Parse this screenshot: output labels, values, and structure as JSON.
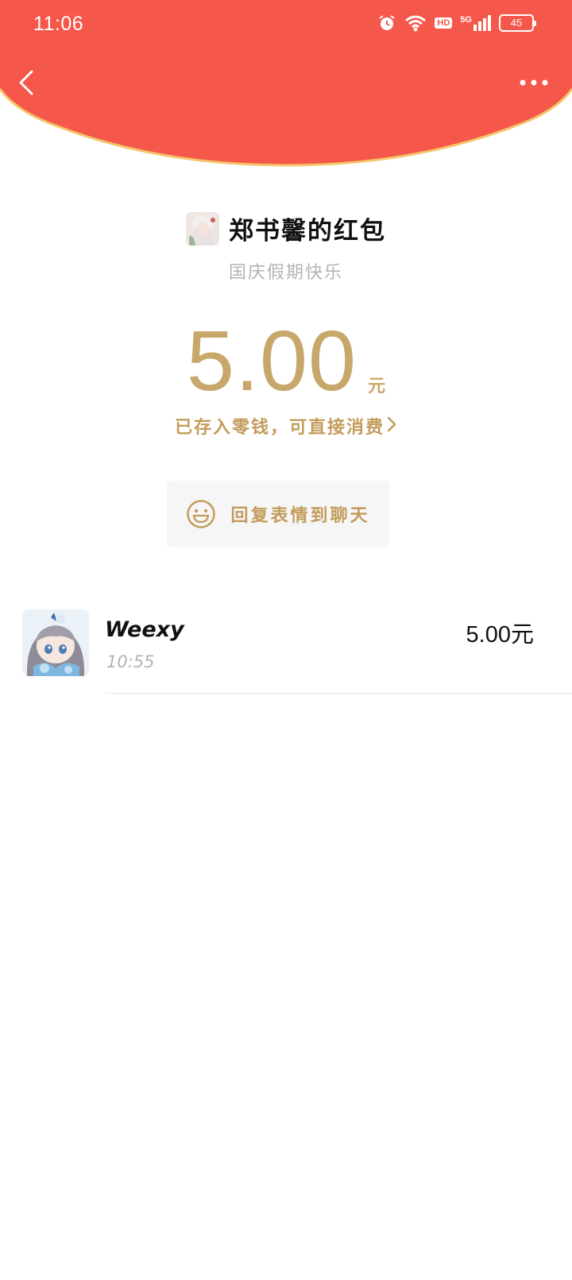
{
  "status_bar": {
    "time": "11:06",
    "hd_label": "HD",
    "network_label": "5G",
    "battery": "45"
  },
  "header": {
    "color": "#f5574a",
    "border_color": "#f4c56a",
    "back_icon": "chevron-left-icon",
    "more_icon": "more-dots-icon"
  },
  "packet": {
    "sender_name": "郑书馨的红包",
    "greeting": "国庆假期快乐",
    "amount": "5.00",
    "unit": "元",
    "saved_text": "已存入零钱，可直接消费",
    "accent_color": "#c8a76b"
  },
  "reply": {
    "label": "回复表情到聊天",
    "icon": "smiley-icon"
  },
  "receivers": [
    {
      "name": "Weexy",
      "time": "10:55",
      "amount": "5.00元"
    }
  ]
}
